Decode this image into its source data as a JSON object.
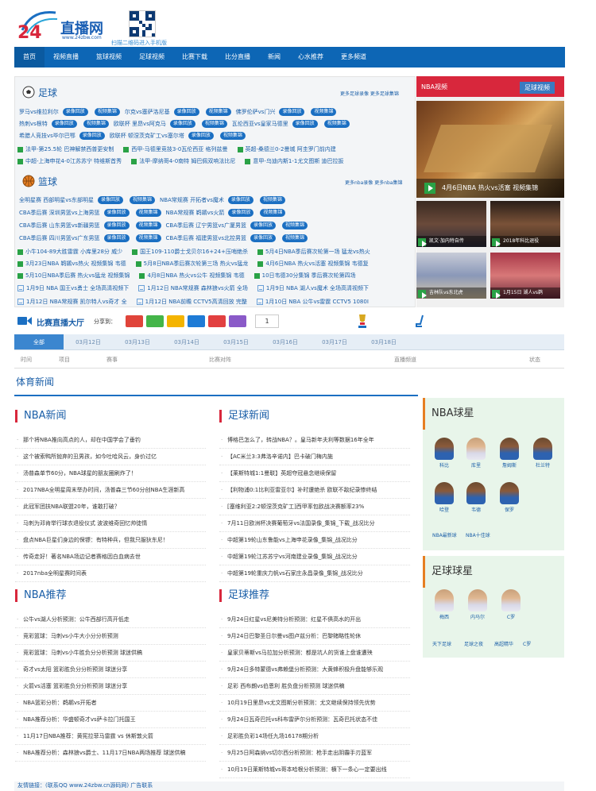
{
  "logo": {
    "main": "直播网",
    "url": "www.24zbw.com",
    "badge": "24"
  },
  "qr": {
    "caption": "扫描二维码进入手机版"
  },
  "nav": [
    "首页",
    "视频直播",
    "篮球视频",
    "足球视频",
    "比赛下载",
    "比分直播",
    "新闻",
    "心水推荐",
    "更多频道"
  ],
  "football": {
    "title": "足球",
    "links": "更多足球录像 更多足球集锦",
    "rows": [
      [
        {
          "t": "罗马vs维拉利尔",
          "tags": [
            "录像回放",
            "视频集锦"
          ]
        },
        {
          "t": "尔克vs塞萨洛尼基",
          "tags": [
            "录像回放",
            "视频集锦"
          ]
        },
        {
          "t": "佛罗伦萨vs门兴",
          "tags": [
            "录像回放",
            "视频集锦"
          ]
        }
      ],
      [
        {
          "t": "热刺vs根特",
          "tags": [
            "录像回放",
            "视频集锦"
          ]
        },
        {
          "t": "欧联杯 里昂vs阿克马",
          "tags": [
            "录像回放",
            "视频集锦"
          ]
        },
        {
          "t": "瓦伦西亚vs皇家马德里",
          "tags": [
            "录像回放",
            "视频集锦"
          ]
        }
      ],
      [
        {
          "t": "希腊人竞技vs毕尔巴鄂",
          "tags": [
            "录像回放"
          ]
        },
        {
          "t": "欧联杯 顿涅茨克矿工vs塞尔塔",
          "tags": [
            "录像回放",
            "视频集锦"
          ]
        }
      ]
    ],
    "green": [
      "法甲-第25.5轮 巴神解禁西普更安制",
      "西甲-马德里竞技3-0瓦伦西亚 格列兹曼",
      "英超-桑德兰0-2曼城 阿圭罗门前内建",
      "中超-上海申花4-0江苏苏宁 特维斯首秀",
      "法甲-摩纳哥4-0南特 姆巴佩双响法比尼",
      "意甲-乌迪内斯1-1尤文图斯 迪巴拉扳"
    ]
  },
  "basketball": {
    "title": "篮球",
    "links": "更多nba录像 更多nba集锦",
    "rows": [
      [
        {
          "t": "全明星赛 西部明星vs东部明星",
          "tags": [
            "录像回放",
            "视频集锦"
          ]
        },
        {
          "t": "NBA常规赛 开拓者vs魔术",
          "tags": [
            "录像回放",
            "视频集锦"
          ]
        }
      ],
      [
        {
          "t": "CBA季后赛 深圳男篮vs上海男篮",
          "tags": [
            "录像回放",
            "视频集锦"
          ]
        },
        {
          "t": "NBA常规赛 鹈鹕vs火箭",
          "tags": [
            "录像回放",
            "视频集锦"
          ]
        }
      ],
      [
        {
          "t": "CBA季后赛 山东男篮vs新疆男篮",
          "tags": [
            "录像回放",
            "视频集锦"
          ]
        },
        {
          "t": "CBA季后赛 辽宁男篮vs广厦男篮",
          "tags": [
            "录像回放",
            "视频集锦"
          ]
        }
      ],
      [
        {
          "t": "CBA季后赛 四川男篮vs广东男篮",
          "tags": [
            "录像回放",
            "视频集锦"
          ]
        },
        {
          "t": "CBA季后赛 福建男篮vs北控男篮",
          "tags": [
            "录像回放",
            "视频集锦"
          ]
        }
      ]
    ],
    "green": [
      "小牛104-89大胜雷霆 小库里28分 威少",
      "国王109-110爵士戈贝尔16+24+压哨绝杀",
      "5月4日NBA季后赛次轮第一场 猛龙vs热火",
      "3月23日NBA 鹈鹕vs热火 视频集锦 韦德",
      "5月8日NBA季后赛次轮第三场 热火vs猛龙",
      "4月6日NBA 热火vs活塞 视频集锦 韦德复",
      "5月10日NBA季后赛 热火vs猛龙 视频集锦",
      "4月8日NBA 热火vs公牛 视频集锦 韦德",
      "10日韦德30分集锦 季后赛次轮第四场"
    ]
  },
  "video_rows": [
    [
      "1月9日 NBA 国王vs勇士 全场高清视频下",
      "1月12日 NBA常规赛 森林狼vs火箭 全场",
      "1月9日 NBA 湖人vs魔术 全场高清视频下"
    ],
    [
      "1月12日 NBA常规赛 凯尔特人vs奇才 全",
      "1月12日 NBA前瞻 CCTV5高清回放 完整",
      "1月10日 NBA 公牛vs雷霆 CCTV5 1080I"
    ]
  ],
  "media": {
    "tab1": "NBA视频",
    "tab2": "足球视频",
    "main_caption": "4月6日NBA 热火vs活塞 视频集锦",
    "thumbs": [
      "凯文·加内特自传",
      "2018年科比退役",
      "吉林队vs东北虎",
      "1月15日 湖人vs鹈"
    ]
  },
  "share": {
    "title": "比赛直播大厅",
    "label": "分享到：",
    "count": "1"
  },
  "dates": [
    "全部",
    "03月12日",
    "03月13日",
    "03月14日",
    "03月15日",
    "03月16日",
    "03月17日",
    "03月18日"
  ],
  "schedule_head": {
    "time": "时间",
    "item": "项目",
    "event": "赛事",
    "match": "比赛对阵",
    "channel": "直播频道",
    "status": "状态"
  },
  "news": {
    "title": "体育新闻",
    "nba_title": "NBA新闻",
    "nba": [
      "那个将NBA推向高点的人，却在中国学会了垂钓",
      "这个被索鸭所抛弃的丑男孩，如今吐哈风云，身价过亿",
      "汤普森单节60分，NBA球星的朋友圈刷炸了！",
      "2017NBA全明星周末举办时间，汤普森三节60分创NBA生涯新高",
      "此冠军团扶NBA联盟20年，谁敢打破？",
      "马刺为邓肯举行球衣退役仪式 波波维奇回忆帅徒情",
      "盘点NBA巨星们身边的保镖：有特种兵，但我只服狄东尼！",
      "传奇走好！著名NBA场边记者赛格因白血病去世",
      "2017nba全明星赛时间表"
    ],
    "fb_title": "足球新闻",
    "fb": [
      "博格巴怎么了，转战NBA？。皇马新年夫利等数据16年全年",
      "【AC米兰3:3弗洛辛诺内】巴卡破门梅内施",
      "【莱斯特城1:1曼联】英超夺冠悬念继续保留",
      "【利物浦0:1比利亚雷亚尔】补时遭绝杀 欧联不敌纪录惨终结",
      "[塞维利亚2:2顿涅茨克矿工]西甲率包欧战决赛额率23%",
      "7月11日欧洲杯决赛葡萄牙vs法国录像_集锦_下载_战况比分",
      "中超第19轮山东鲁能vs上海申花录像_集锦_战况比分",
      "中超第19轮江苏苏宁vs河南建业录像_集锦_战况比分",
      "中超第19轮重庆力帆vs石家庄永昌录像_集锦_战况比分"
    ],
    "nba_rec_title": "NBA推荐",
    "nba_rec": [
      "公牛vs湖人分析预测：公牛西部行高开低走",
      "竞彩篮球：马刺vs小牛大小分分析预测",
      "竞彩篮球：马刺vs小牛胜负分分析预测 球迷供稿",
      "奇才vs太阳 篮彩胜负分分析预测 球迷分享",
      "火箭vs活塞 篮彩胜负分分析预测 球迷分享",
      "NBA篮彩分析：鹈鹕vs开拓者",
      "NBA推荐分析：华盛顿奇才vs萨卡拉门托国王",
      "11月17日NBA推荐：黄宪拉菲马雷霆 vs 休斯敦火箭",
      "NBA推荐分析：森林狼vs爵士、11月17日NBA两场推荐 球迷供稿"
    ],
    "fb_rec_title": "足球推荐",
    "fb_rec": [
      "9月24日红星vs尼美特分析预测：红星不俱高水的开出",
      "9月24日巴黎圣日尔曼vs图卢兹分析：巴黎赌略性轮休",
      "皇家贝蒂斯vs马拉加分析预测：都是坑人的货谁上盘谁遭殃",
      "9月24日多特蒙德vs弗赖堡分析预测：大黄蜂积极升盘能够乐观",
      "足彩 西布朗vs伯恩利 胜负盘分析预测 球迷供稿",
      "10月19日里昂vs尤文图斯分析预测：尤文继续保持领先优势",
      "9月24日瓦奇巴托vs科布雷萨尔分析预测：瓦奇巴托状态不佳",
      "足彩胜负彩14场任九场16178期分析",
      "9月25日阿森纳vs切尔西分析预测：枪手走出阴霾手刃蓝军",
      "10月19日莱斯特城vs哥本哈根分析预测：横下一条心一定要出线"
    ]
  },
  "nba_stars": {
    "title": "NBA球星",
    "players": [
      "科比",
      "库里",
      "詹姆斯",
      "杜兰特",
      "哈登",
      "韦德",
      "保罗"
    ],
    "links": [
      "NBA最新球",
      "NBA十佳球"
    ]
  },
  "fb_stars": {
    "title": "足球球星",
    "players": [
      "梅西",
      "内马尔",
      "C罗"
    ],
    "links": [
      "天下足球",
      "足球之夜",
      "高超精华",
      "C罗"
    ]
  },
  "footer": "友情链接：(联系QQ www.24zbw.cn源码网) 广告联系"
}
